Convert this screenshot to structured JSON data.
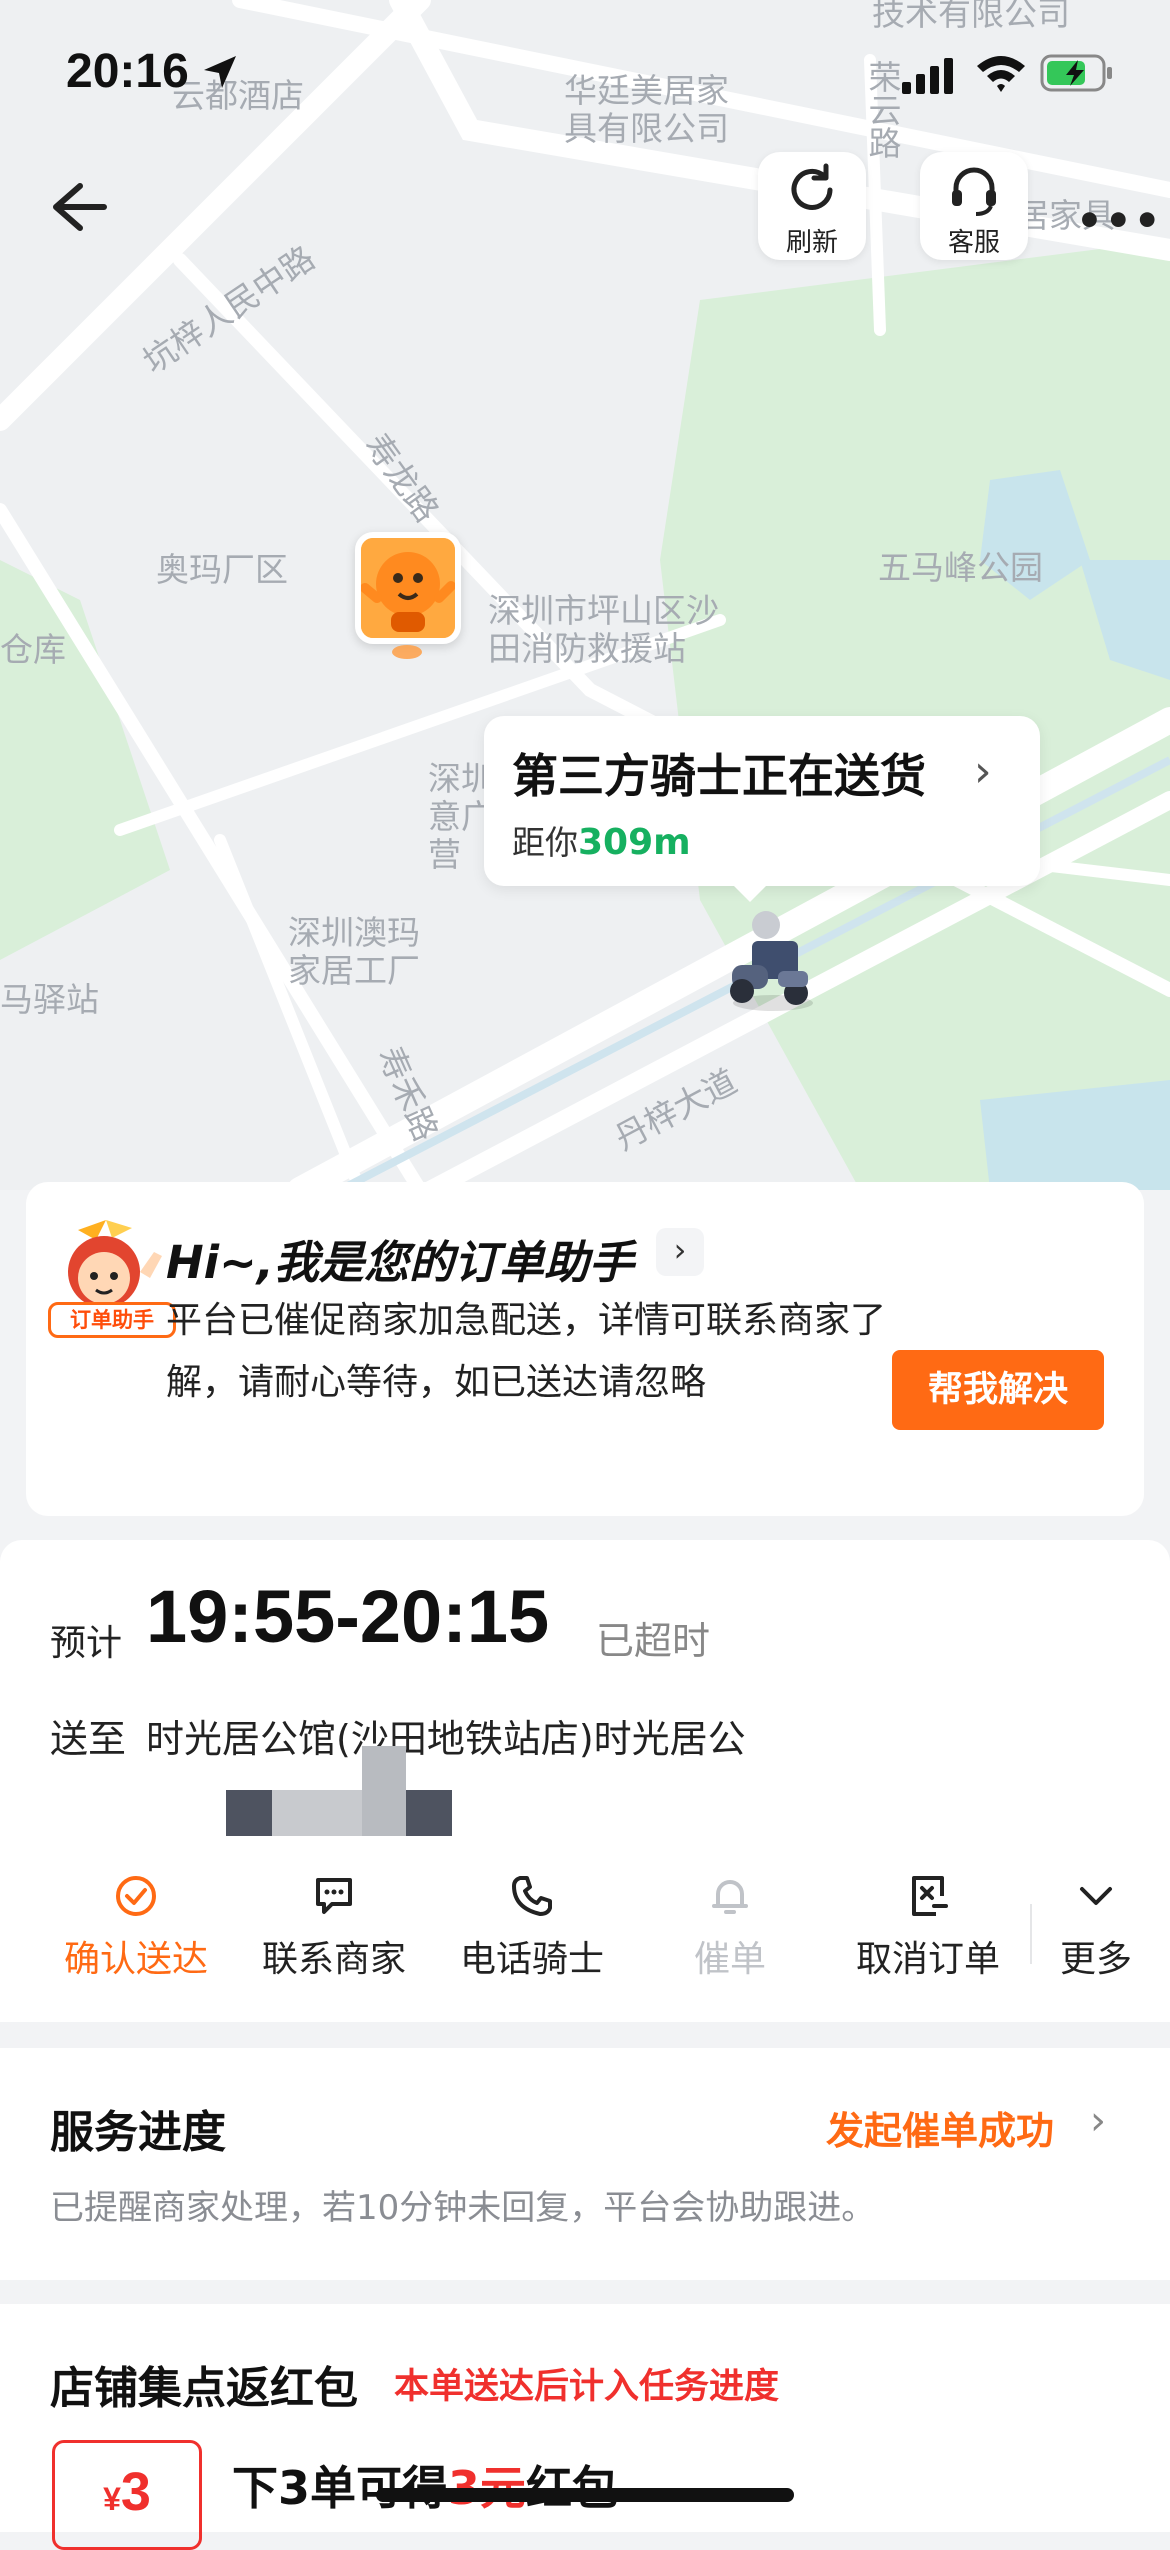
{
  "status_bar": {
    "time": "20:16"
  },
  "map": {
    "labels": [
      "坑梓人民中路",
      "云都酒店",
      "华廷美居家\n具有限公司",
      "技术有限公司",
      "荣云路",
      "居家具",
      "寿龙路",
      "奥玛厂区",
      "深圳市坪山区沙\n田消防救援站",
      "五马峰公园",
      "仓库",
      "深圳澳玛\n家居工厂",
      "马驿站",
      "寿禾路",
      "丹梓大道",
      "深圳\n意广\n营"
    ],
    "refresh_label": "刷新",
    "service_label": "客服"
  },
  "rider_card": {
    "title": "第三方骑士正在送货",
    "distance_prefix": "距你",
    "distance_value": "309m"
  },
  "assistant": {
    "tag": "订单助手",
    "title": "Hi~,我是您的订单助手",
    "body": "平台已催促商家加急配送，详情可联系商家了解，请耐心等待，如已送达请忽略",
    "button": "帮我解决"
  },
  "order": {
    "eta_prefix": "预计",
    "eta_time": "19:55-20:15",
    "eta_status": "已超时",
    "address_prefix": "送至",
    "address": "时光居公馆(沙田地铁站店)时光居公",
    "actions": [
      {
        "label": "确认送达",
        "icon": "check-circle-icon",
        "state": "active"
      },
      {
        "label": "联系商家",
        "icon": "chat-icon",
        "state": "normal"
      },
      {
        "label": "电话骑士",
        "icon": "phone-icon",
        "state": "normal"
      },
      {
        "label": "催单",
        "icon": "bell-icon",
        "state": "disabled"
      },
      {
        "label": "取消订单",
        "icon": "cancel-order-icon",
        "state": "normal"
      },
      {
        "label": "更多",
        "icon": "chevron-down-icon",
        "state": "normal"
      }
    ]
  },
  "service": {
    "title": "服务进度",
    "status": "发起催单成功",
    "desc": "已提醒商家处理，若10分钟未回复，平台会协助跟进。"
  },
  "reward": {
    "title": "店铺集点返红包",
    "subtitle": "本单送达后计入任务进度",
    "coupon_symbol": "¥",
    "coupon_value": "3",
    "line_a": "下3单可得",
    "line_b": "3元",
    "line_c": "红包"
  },
  "colors": {
    "accent": "#ff6a14",
    "green": "#16b060",
    "red": "#f0302d"
  }
}
